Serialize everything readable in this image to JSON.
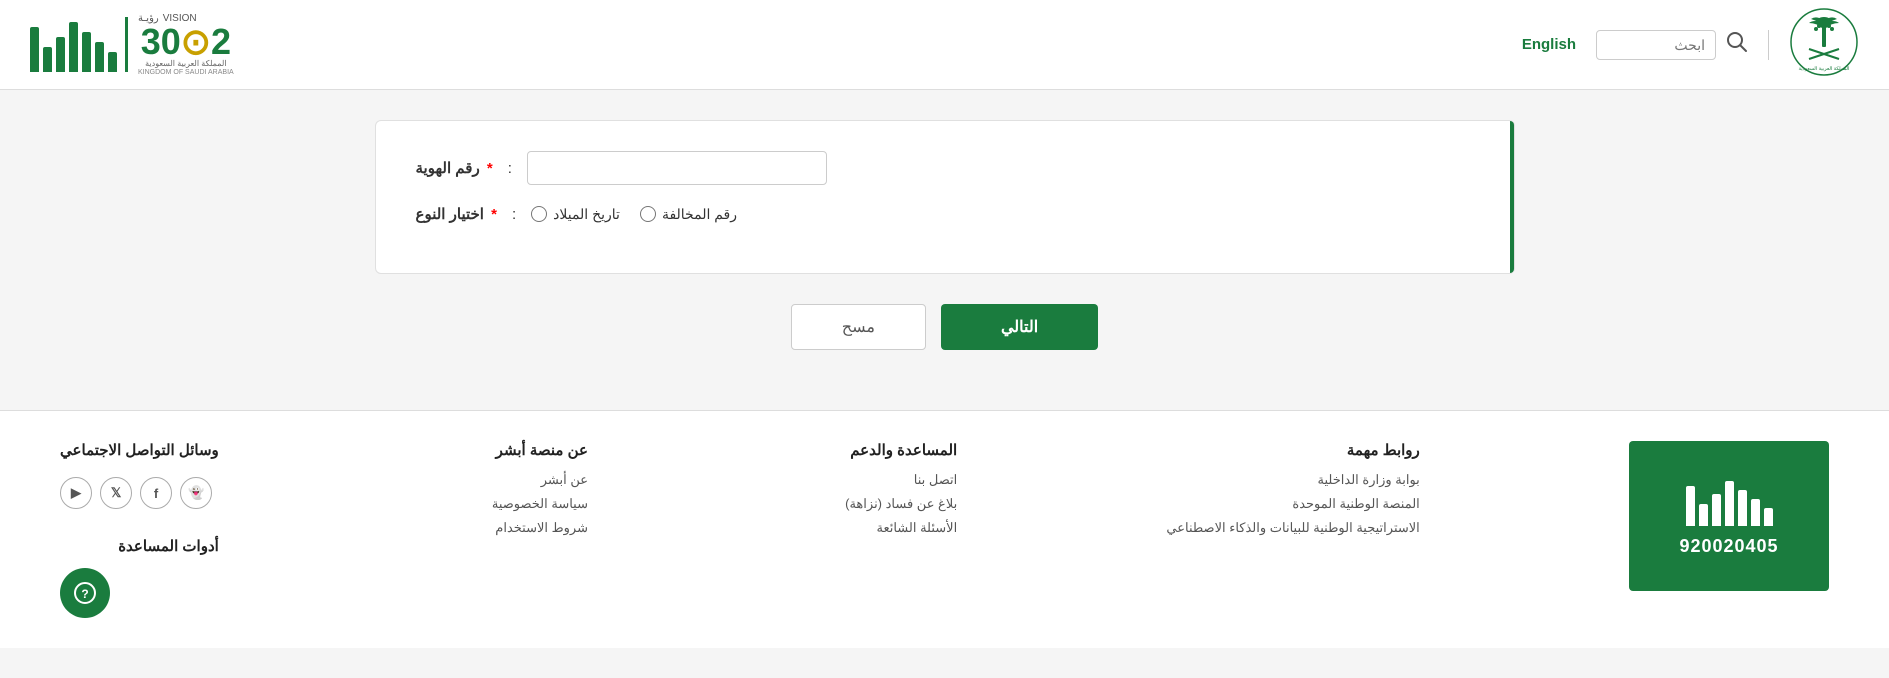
{
  "header": {
    "search_placeholder": "ابحث",
    "lang_label": "English",
    "vision_line1": "رؤيـة",
    "vision_2030": "2030",
    "kingdom": "المملكة العربية السعودية",
    "kingdom_en": "KINGDOM OF SAUDI ARABIA",
    "vision_en": "VISION"
  },
  "form": {
    "id_label": "رقم الهوية",
    "type_label": "اختيار النوع",
    "required_star": "*",
    "colon": ":",
    "violation_number": "رقم المخالفة",
    "birth_date": "تاريخ الميلاد",
    "btn_next": "التالي",
    "btn_clear": "مسح"
  },
  "footer": {
    "phone": "920020405",
    "social_title": "وسائل التواصل الاجتماعي",
    "tools_title": "أدوات المساعدة",
    "absher_section": {
      "snapchat": "👻",
      "facebook": "f",
      "twitter": "𝕏",
      "youtube": "▶"
    },
    "about_absher": {
      "title": "عن منصة أبشر",
      "links": [
        "عن أبشر",
        "سياسة الخصوصية",
        "شروط الاستخدام"
      ]
    },
    "support": {
      "title": "المساعدة والدعم",
      "links": [
        "اتصل بنا",
        "بلاغ عن فساد (نزاهة)",
        "الأسئلة الشائعة"
      ]
    },
    "important_links": {
      "title": "روابط مهمة",
      "links": [
        "بوابة وزارة الداخلية",
        "المنصة الوطنية الموحدة",
        "الاستراتيجية الوطنية للبيانات والذكاء الاصطناعي"
      ]
    }
  }
}
